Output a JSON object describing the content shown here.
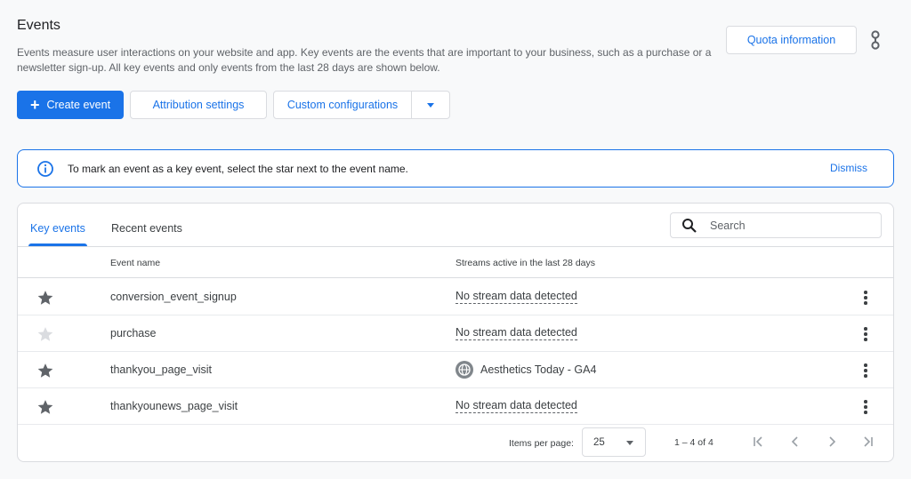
{
  "header": {
    "title": "Events",
    "description": "Events measure user interactions on your website and app. Key events are the events that are important to your business, such as a purchase or a newsletter sign-up. All key events and only events from the last 28 days are shown below.",
    "quota_label": "Quota information"
  },
  "toolbar": {
    "create_label": "Create event",
    "attribution_label": "Attribution settings",
    "custom_label": "Custom configurations"
  },
  "banner": {
    "message": "To mark an event as a key event, select the star next to the event name.",
    "dismiss_label": "Dismiss"
  },
  "tabs": [
    {
      "label": "Key events",
      "active": true
    },
    {
      "label": "Recent events",
      "active": false
    }
  ],
  "search": {
    "placeholder": "Search"
  },
  "table": {
    "columns": [
      "Event name",
      "Streams active in the last 28 days"
    ],
    "rows": [
      {
        "name": "conversion_event_signup",
        "stream": "No stream data detected",
        "starred": true
      },
      {
        "name": "purchase",
        "stream": "No stream data detected",
        "starred": false
      },
      {
        "name": "thankyou_page_visit",
        "stream": "Aesthetics Today - GA4",
        "starred": true
      },
      {
        "name": "thankyounews_page_visit",
        "stream": "No stream data detected",
        "starred": true
      }
    ]
  },
  "pagination": {
    "items_per_page_label": "Items per page:",
    "items_per_page": "25",
    "range": "1 – 4 of 4"
  },
  "colors": {
    "accent": "#1a73e8",
    "star_active": "#5f6368",
    "star_inactive": "#dadce0"
  }
}
